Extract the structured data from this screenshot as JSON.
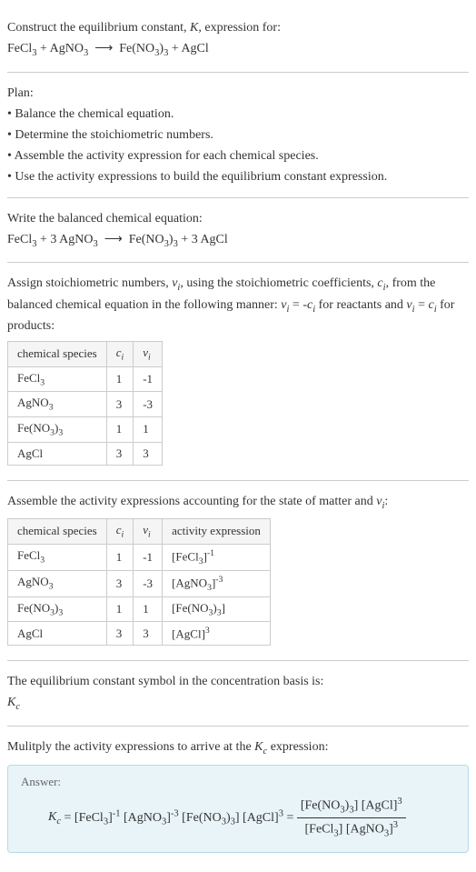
{
  "prompt": {
    "line1": "Construct the equilibrium constant, K, expression for:",
    "equation": "FeCl₃ + AgNO₃ ⟶ Fe(NO₃)₃ + AgCl"
  },
  "plan": {
    "title": "Plan:",
    "items": [
      "Balance the chemical equation.",
      "Determine the stoichiometric numbers.",
      "Assemble the activity expression for each chemical species.",
      "Use the activity expressions to build the equilibrium constant expression."
    ]
  },
  "balanced": {
    "title": "Write the balanced chemical equation:",
    "equation": "FeCl₃ + 3 AgNO₃ ⟶ Fe(NO₃)₃ + 3 AgCl"
  },
  "stoich": {
    "intro": "Assign stoichiometric numbers, νᵢ, using the stoichiometric coefficients, cᵢ, from the balanced chemical equation in the following manner: νᵢ = -cᵢ for reactants and νᵢ = cᵢ for products:",
    "headers": [
      "chemical species",
      "cᵢ",
      "νᵢ"
    ],
    "rows": [
      [
        "FeCl₃",
        "1",
        "-1"
      ],
      [
        "AgNO₃",
        "3",
        "-3"
      ],
      [
        "Fe(NO₃)₃",
        "1",
        "1"
      ],
      [
        "AgCl",
        "3",
        "3"
      ]
    ]
  },
  "activity": {
    "intro": "Assemble the activity expressions accounting for the state of matter and νᵢ:",
    "headers": [
      "chemical species",
      "cᵢ",
      "νᵢ",
      "activity expression"
    ],
    "rows": [
      [
        "FeCl₃",
        "1",
        "-1",
        "[FeCl₃]⁻¹"
      ],
      [
        "AgNO₃",
        "3",
        "-3",
        "[AgNO₃]⁻³"
      ],
      [
        "Fe(NO₃)₃",
        "1",
        "1",
        "[Fe(NO₃)₃]"
      ],
      [
        "AgCl",
        "3",
        "3",
        "[AgCl]³"
      ]
    ]
  },
  "symbol": {
    "line1": "The equilibrium constant symbol in the concentration basis is:",
    "line2": "K_c"
  },
  "multiply": {
    "title": "Mulitply the activity expressions to arrive at the K_c expression:"
  },
  "answer": {
    "label": "Answer:",
    "lhs": "K_c = [FeCl₃]⁻¹ [AgNO₃]⁻³ [Fe(NO₃)₃] [AgCl]³ = ",
    "num": "[Fe(NO₃)₃] [AgCl]³",
    "den": "[FeCl₃] [AgNO₃]³"
  }
}
